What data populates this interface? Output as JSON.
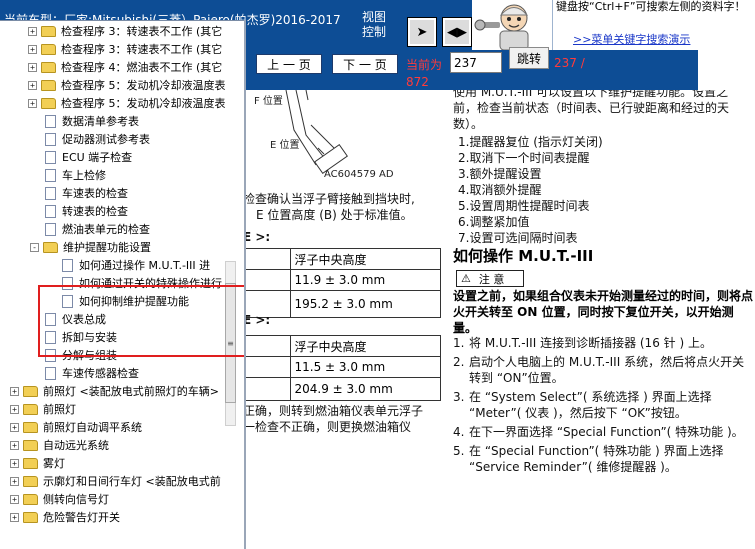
{
  "header": {
    "model_label": "当前车型：厂家:Mitsubishi(三菱）Pajero(帕杰罗)2016-2017",
    "view_control_label": "视图控制",
    "tip_text": "键盘按“Ctrl+F”可搜索左侧的资料字！",
    "tip_link": ">>菜单关键字搜索演示"
  },
  "tree": {
    "items": [
      {
        "type": "folder",
        "expander": "+",
        "label": "检查程序 3：转速表不工作 (其它"
      },
      {
        "type": "folder",
        "expander": "+",
        "label": "检查程序 3：转速表不工作 (其它"
      },
      {
        "type": "folder",
        "expander": "+",
        "label": "检查程序 4：燃油表不工作 (其它"
      },
      {
        "type": "folder",
        "expander": "+",
        "label": "检查程序 5：发动机冷却液温度表"
      },
      {
        "type": "folder",
        "expander": "+",
        "label": "检查程序 5：发动机冷却液温度表"
      },
      {
        "type": "doc",
        "label": "数据清单参考表"
      },
      {
        "type": "doc",
        "label": "促动器测试参考表"
      },
      {
        "type": "doc",
        "label": "ECU 端子检查"
      },
      {
        "type": "doc",
        "label": "车上检修"
      },
      {
        "type": "doc",
        "label": "车速表的检查"
      },
      {
        "type": "doc",
        "label": "转速表的检查"
      },
      {
        "type": "doc",
        "label": "燃油表单元的检查"
      },
      {
        "type": "folder",
        "expander": "-",
        "label": "维护提醒功能设置"
      },
      {
        "type": "doc",
        "label": "如何通过操作 M.U.T.-III 进"
      },
      {
        "type": "doc",
        "label": "如何通过开关的特殊操作进行"
      },
      {
        "type": "doc",
        "label": "如何抑制维护提醒功能"
      },
      {
        "type": "doc",
        "label": "仪表总成"
      },
      {
        "type": "doc",
        "label": "拆卸与安装"
      },
      {
        "type": "doc",
        "label": "分解与组装"
      },
      {
        "type": "doc",
        "label": "车速传感器检查"
      },
      {
        "type": "folder",
        "expander": "+",
        "label": "前照灯 <装配放电式前照灯的车辆>"
      },
      {
        "type": "folder",
        "expander": "+",
        "label": "前照灯"
      },
      {
        "type": "folder",
        "expander": "+",
        "label": "前照灯自动调平系统"
      },
      {
        "type": "folder",
        "expander": "+",
        "label": "自动远光系统"
      },
      {
        "type": "folder",
        "expander": "+",
        "label": "雾灯"
      },
      {
        "type": "folder",
        "expander": "+",
        "label": "示廓灯和日间行车灯 <装配放电式前"
      },
      {
        "type": "folder",
        "expander": "+",
        "label": "侧转向信号灯"
      },
      {
        "type": "folder",
        "expander": "+",
        "label": "危险警告灯开关"
      }
    ]
  },
  "nav": {
    "prev_label": "上 一 页",
    "next_label": "下 一 页",
    "current_label": "当前为",
    "current_value": "237",
    "jump_label": "跳转",
    "page_of": "237 /",
    "page_total": "872"
  },
  "document": {
    "figure_labels": {
      "f_pos": "F 位置",
      "e_pos": "E 位置",
      "code": "AC604579 AD"
    },
    "left_lines": [
      "检查确认当浮子臂接触到挡块时,",
      "E 位置高度 (B) 处于标准值。"
    ],
    "label_tbl1": "E >:",
    "table1": {
      "header": "浮子中央高度",
      "rows": [
        "11.9 ± 3.0 mm",
        "195.2 ± 3.0 mm"
      ]
    },
    "label_tbl2": "E >:",
    "table2": {
      "header": "浮子中央高度",
      "rows": [
        "11.5 ± 3.0 mm",
        "204.9 ± 3.0 mm"
      ]
    },
    "bottom_lines": [
      "正确，则转到燃油箱仪表单元浮子",
      "一检查不正确，则更换燃油箱仪"
    ],
    "intro_lines": [
      "使用 M.U.T.-III 可以设置以下维护提醒功能。设置之",
      "前，检查当前状态（时间表、已行驶距离和经过的天",
      "数）。"
    ],
    "steps": [
      "1.提醒器复位 (指示灯关闭)",
      "2.取消下一个时间表提醒",
      "3.额外提醒设置",
      "4.取消额外提醒",
      "5.设置周期性提醒时间表",
      "6.调整紧加值",
      "7.设置可选间隔时间表"
    ],
    "heading": "如何操作 M.U.T.-III",
    "caution_label": "注 意",
    "caution_text": "设置之前，如果组合仪表未开始测量经过的时间，则将点火开关转至 ON 位置，同时按下复位开关，以开始测量。",
    "procedure": [
      {
        "num": "1.",
        "text": "将 M.U.T.-III 连接到诊断插接器 (16 针 ) 上。"
      },
      {
        "num": "2.",
        "text": "启动个人电脑上的 M.U.T.-III 系统，然后将点火开关转到 “ON”位置。"
      },
      {
        "num": "3.",
        "text": "在 “System Select”( 系统选择 ) 界面上选择 “Meter”( 仪表 )，然后按下 “OK”按钮。"
      },
      {
        "num": "4.",
        "text": "在下一界面选择 “Special Function”( 特殊功能 )。"
      },
      {
        "num": "5.",
        "text": "在 “Special Function”( 特殊功能 ) 界面上选择 “Service Reminder”( 维修提醒器 )。"
      }
    ]
  }
}
